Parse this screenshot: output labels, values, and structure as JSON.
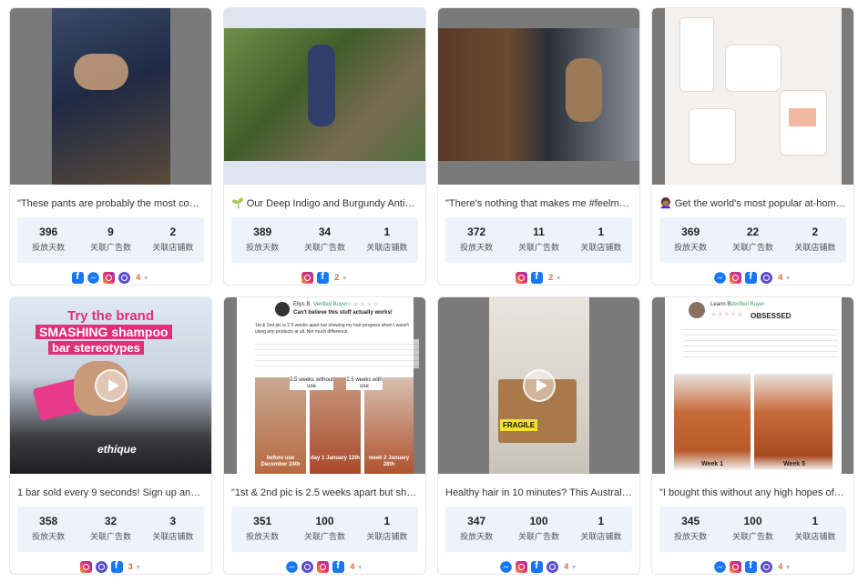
{
  "stat_labels": {
    "days": "投放天数",
    "ads": "关联广告数",
    "stores": "关联店铺数"
  },
  "cards": [
    {
      "title": "\"These pants are probably the most comfo...",
      "days": "396",
      "ads": "9",
      "stores": "2",
      "platforms": [
        "facebook-icon",
        "messenger-icon",
        "instagram-icon",
        "audience-network-icon"
      ],
      "more": "4"
    },
    {
      "title": "🌱 Our Deep Indigo and Burgundy Antido...",
      "days": "389",
      "ads": "34",
      "stores": "1",
      "platforms": [
        "instagram-icon",
        "facebook-icon"
      ],
      "more": "2"
    },
    {
      "title": "\"There's nothing that makes me #feelmore...",
      "days": "372",
      "ads": "11",
      "stores": "1",
      "platforms": [
        "instagram-icon",
        "facebook-icon"
      ],
      "more": "2"
    },
    {
      "title": "👩🏽‍🦱 Get the world's most popular at-home ...",
      "days": "369",
      "ads": "22",
      "stores": "2",
      "platforms": [
        "messenger-icon",
        "instagram-icon",
        "facebook-icon",
        "audience-network-icon"
      ],
      "more": "4"
    },
    {
      "title": "1 bar sold every 9 seconds! Sign up and r...",
      "days": "358",
      "ads": "32",
      "stores": "3",
      "platforms": [
        "instagram-icon",
        "audience-network-icon",
        "facebook-icon"
      ],
      "more": "3",
      "overlay": {
        "line1": "Try the brand",
        "line2": "SMASHING shampoo",
        "line3": "bar stereotypes",
        "brand": "ethique"
      }
    },
    {
      "title": "\"1st & 2nd pic is 2.5 weeks apart but show...",
      "days": "351",
      "ads": "100",
      "stores": "1",
      "platforms": [
        "messenger-icon",
        "audience-network-icon",
        "instagram-icon",
        "facebook-icon"
      ],
      "more": "4",
      "overlay": {
        "name": "Ellys B.",
        "badge": "Verified Buyer",
        "headline": "Can't believe this stuff actually works!",
        "body": "1st & 2nd pic is 2.5 weeks apart but showing my hair progress when I wasn't using any products at all. Not much difference.",
        "cap1": "2.5 weeks without use",
        "cap2": "2.5 weeks with use",
        "d1": "before use December 24th",
        "d2": "day 1 January 12th",
        "d3": "week 2 January 28th"
      }
    },
    {
      "title": "Healthy hair in 10 minutes? This Australia...",
      "days": "347",
      "ads": "100",
      "stores": "1",
      "platforms": [
        "messenger-icon",
        "instagram-icon",
        "facebook-icon",
        "audience-network-icon"
      ],
      "more": "4",
      "overlay": {
        "label": "FRAGILE"
      }
    },
    {
      "title": "\"I bought this without any high hopes of it ...",
      "days": "345",
      "ads": "100",
      "stores": "1",
      "platforms": [
        "messenger-icon",
        "instagram-icon",
        "facebook-icon",
        "audience-network-icon"
      ],
      "more": "4",
      "overlay": {
        "name": "Leann B.",
        "badge": "Verified Buyer",
        "headline": "OBSESSED",
        "w1": "Week 1",
        "w2": "Week 5"
      }
    }
  ]
}
